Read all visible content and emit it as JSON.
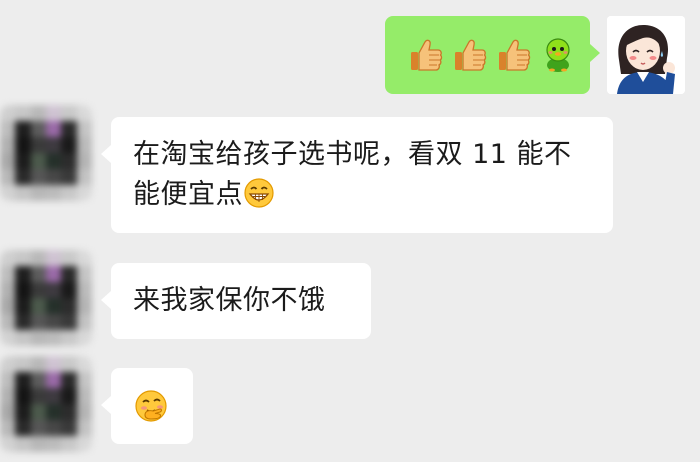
{
  "messages": [
    {
      "sender": "me",
      "emojis": [
        "thumbs-up",
        "thumbs-up",
        "thumbs-up",
        "green-chick"
      ]
    },
    {
      "sender": "contact",
      "text": "在淘宝给孩子选书呢，看双 11 能不能便宜点",
      "trailing_emoji": "grin"
    },
    {
      "sender": "contact",
      "text": "来我家保你不饿"
    },
    {
      "sender": "contact",
      "emoji": "shy-laugh"
    }
  ],
  "colors": {
    "background": "#ededed",
    "my_bubble": "#95ec69",
    "contact_bubble": "#ffffff",
    "text": "#1b1b1b"
  }
}
